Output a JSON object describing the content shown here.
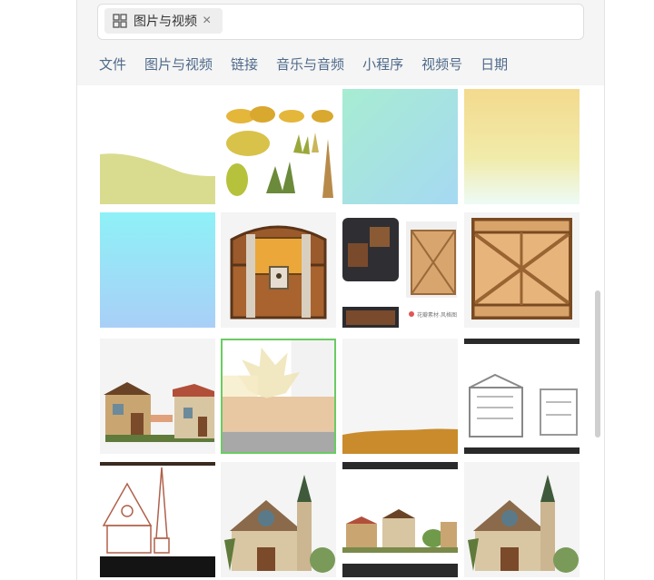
{
  "search": {
    "filter_chip_label": "图片与视频",
    "filter_chip_icon": "grid-icon",
    "remove_icon": "close-icon"
  },
  "tabs": [
    {
      "label": "文件"
    },
    {
      "label": "图片与视频"
    },
    {
      "label": "链接"
    },
    {
      "label": "音乐与音频"
    },
    {
      "label": "小程序"
    },
    {
      "label": "视频号"
    },
    {
      "label": "日期"
    }
  ],
  "thumbnails": [
    {
      "name": "hill-landscape"
    },
    {
      "name": "bush-sprites"
    },
    {
      "name": "mint-gradient"
    },
    {
      "name": "yellow-gradient"
    },
    {
      "name": "sky-gradient"
    },
    {
      "name": "treasure-chest"
    },
    {
      "name": "wooden-crates-photo",
      "caption": "花瓣素材·风格图"
    },
    {
      "name": "wooden-crate"
    },
    {
      "name": "cottage-houses"
    },
    {
      "name": "autumn-leaf-sprite",
      "selected": true
    },
    {
      "name": "desert-ground"
    },
    {
      "name": "sketch-houses"
    },
    {
      "name": "church-line-art"
    },
    {
      "name": "church-illustration"
    },
    {
      "name": "village-strip"
    },
    {
      "name": "church-illustration-2"
    }
  ],
  "colors": {
    "tab_text": "#4f6a8a",
    "selected_border": "#6acb63",
    "header_bg": "#f5f5f5"
  }
}
